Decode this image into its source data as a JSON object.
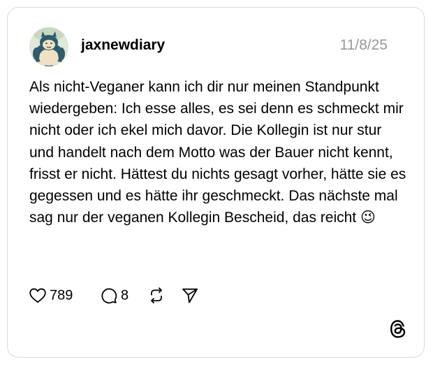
{
  "post": {
    "username": "jaxnewdiary",
    "timestamp": "11/8/25",
    "text": "Als nicht-Veganer kann ich dir nur meinen Standpunkt wiedergeben: Ich esse alles, es sei denn es schmeckt mir nicht oder ich ekel mich davor. Die Kollegin ist nur stur und handelt nach dem Motto was der Bauer nicht kennt, frisst er nicht. Hättest du nichts gesagt vorher, hätte sie es gegessen und es hätte ihr geschmeckt. Das nächste mal sag nur der veganen Kollegin Bescheid, das reicht 😉",
    "avatar_icon": "snorlax-avatar"
  },
  "actions": {
    "like_icon": "heart-icon",
    "like_count": "789",
    "reply_icon": "comment-icon",
    "reply_count": "8",
    "repost_icon": "repost-icon",
    "share_icon": "send-icon"
  },
  "brand": {
    "logo": "threads-logo-icon"
  },
  "colors": {
    "timestamp": "#999999",
    "border": "#d9d9d9",
    "text": "#000000"
  }
}
